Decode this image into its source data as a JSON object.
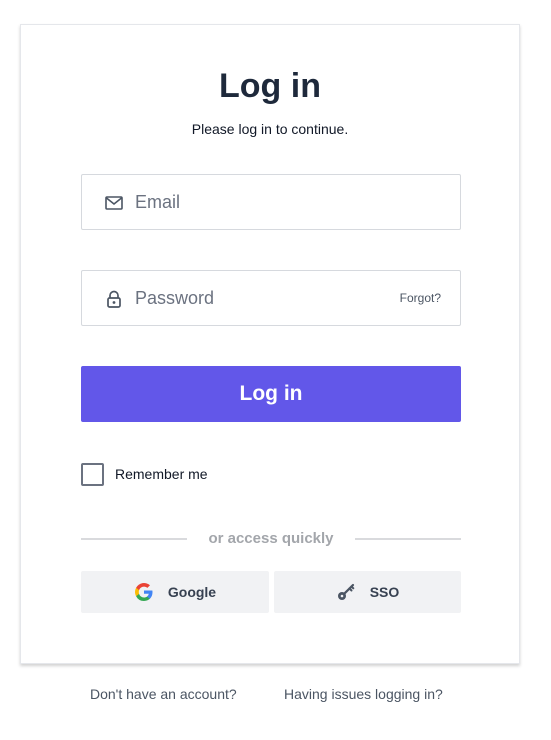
{
  "login": {
    "title": "Log in",
    "subtitle": "Please log in to continue.",
    "email": {
      "placeholder": "Email",
      "value": "",
      "icon": "mail-icon"
    },
    "password": {
      "placeholder": "Password",
      "value": "",
      "icon": "lock-icon",
      "forgot_label": "Forgot?"
    },
    "submit_label": "Log in",
    "remember": {
      "label": "Remember me",
      "checked": false
    },
    "divider_text": "or access quickly",
    "social": {
      "google": {
        "label": "Google",
        "icon": "google-icon"
      },
      "sso": {
        "label": "SSO",
        "icon": "key-icon"
      }
    }
  },
  "footer": {
    "signup_link": "Don't have an account?",
    "issues_link": "Having issues logging in?"
  },
  "colors": {
    "primary": "#6257e9",
    "title_text": "#1e293b",
    "social_bg": "#f1f2f4",
    "divider_text": "#a3a6ab"
  }
}
